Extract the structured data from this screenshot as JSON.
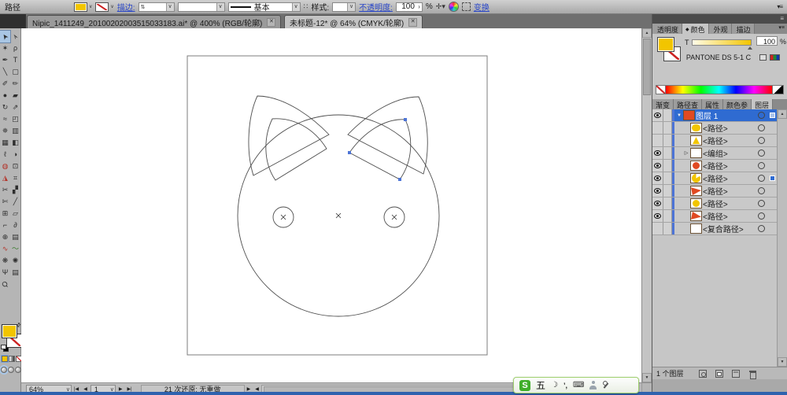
{
  "control_bar": {
    "context_label": "路径",
    "stroke_label": "描边:",
    "brush_name": "基本",
    "style_label": "样式:",
    "opacity_label": "不透明度:",
    "opacity_value": "100",
    "opacity_unit": "%",
    "transform_label": "变换"
  },
  "document_tabs": [
    {
      "title": "Nipic_1411249_20100202003515033183.ai* @ 400% (RGB/轮廓)"
    },
    {
      "title": "未标题-12* @ 64% (CMYK/轮廓)"
    }
  ],
  "toolbar": {
    "tools": [
      {
        "name": "selection-tool",
        "glyph": "➤",
        "cls": "active arrow"
      },
      {
        "name": "direct-selection-tool",
        "glyph": "➢",
        "cls": "arrow"
      },
      {
        "name": "magic-wand-tool",
        "glyph": "✶"
      },
      {
        "name": "lasso-tool",
        "glyph": "ρ"
      },
      {
        "name": "pen-tool",
        "glyph": "✒"
      },
      {
        "name": "type-tool",
        "glyph": "T"
      },
      {
        "name": "line-segment-tool",
        "glyph": "╲"
      },
      {
        "name": "rectangle-tool",
        "glyph": "▢"
      },
      {
        "name": "paintbrush-tool",
        "glyph": "✐"
      },
      {
        "name": "pencil-tool",
        "glyph": "✏"
      },
      {
        "name": "blob-brush-tool",
        "glyph": "●"
      },
      {
        "name": "eraser-tool",
        "glyph": "▰"
      },
      {
        "name": "rotate-tool",
        "glyph": "↻"
      },
      {
        "name": "scale-tool",
        "glyph": "⇗"
      },
      {
        "name": "warp-tool",
        "glyph": "≈"
      },
      {
        "name": "free-transform-tool",
        "glyph": "◰"
      },
      {
        "name": "symbol-sprayer-tool",
        "glyph": "✵"
      },
      {
        "name": "column-graph-tool",
        "glyph": "▥"
      },
      {
        "name": "mesh-tool",
        "glyph": "▦"
      },
      {
        "name": "gradient-tool",
        "glyph": "◧"
      },
      {
        "name": "eyedropper-tool",
        "glyph": "ℓ"
      },
      {
        "name": "blend-tool",
        "glyph": "◑"
      },
      {
        "name": "live-paint-bucket-tool",
        "glyph": "◍",
        "cls": "c-red"
      },
      {
        "name": "live-paint-selection-tool",
        "glyph": "⊡"
      },
      {
        "name": "live-trace-tool",
        "glyph": "◮",
        "cls": "c-red"
      },
      {
        "name": "crop-area-tool",
        "glyph": "⌗"
      },
      {
        "name": "slice-tool",
        "glyph": "✂"
      },
      {
        "name": "slice-selection-tool",
        "glyph": "▞"
      },
      {
        "name": "scissors-tool",
        "glyph": "✄"
      },
      {
        "name": "knife-tool",
        "glyph": "╱"
      },
      {
        "name": "artboard-tool",
        "glyph": "⊞"
      },
      {
        "name": "page-tool",
        "glyph": "▱"
      },
      {
        "name": "measure-tool",
        "glyph": "⌐"
      },
      {
        "name": "spiral-tool",
        "glyph": "∂"
      },
      {
        "name": "polar-grid-tool",
        "glyph": "⊕"
      },
      {
        "name": "rectangular-grid-tool",
        "glyph": "▤"
      },
      {
        "name": "width-tool",
        "glyph": "∿",
        "cls": "c-red"
      },
      {
        "name": "wrinkle-tool",
        "glyph": "〜",
        "cls": "c-green"
      },
      {
        "name": "bloat-tool",
        "glyph": "❋"
      },
      {
        "name": "twirl-tool",
        "glyph": "✺"
      },
      {
        "name": "hand-tool",
        "glyph": "Ψ"
      },
      {
        "name": "print-tiling-tool",
        "glyph": "▤"
      },
      {
        "name": "zoom-tool",
        "glyph": "Ϙ",
        "cls": "rotz"
      },
      {
        "name": "empty-slot",
        "glyph": ""
      }
    ]
  },
  "panels": {
    "group1_tabs": [
      {
        "name": "tab-transparency",
        "label": "透明度"
      },
      {
        "name": "tab-color",
        "label": "颜色",
        "cls": "active",
        "icon": "◆"
      },
      {
        "name": "tab-appearance",
        "label": "外观"
      },
      {
        "name": "tab-stroke",
        "label": "描边"
      }
    ],
    "color": {
      "tint_label": "T",
      "tint_value": "100",
      "tint_unit": "%",
      "swatch_name": "PANTONE DS 5-1 C"
    },
    "group2_tabs": [
      {
        "name": "tab-gradient",
        "label": "渐变"
      },
      {
        "name": "tab-pathfinder",
        "label": "路径查"
      },
      {
        "name": "tab-attributes",
        "label": "属性"
      },
      {
        "name": "tab-color-guide",
        "label": "颜色参"
      },
      {
        "name": "tab-layers",
        "label": "图层",
        "cls": "active"
      }
    ],
    "layers": {
      "rows": [
        {
          "name": "layer-row-layer1",
          "label": "图层 1",
          "eye": true,
          "thumb": "t-red",
          "rowcls": "sel",
          "expander": "▼",
          "selchip": "chip-light"
        },
        {
          "name": "layer-row-path",
          "label": "<路径>",
          "eye": false,
          "thumb": "t-yellow-round",
          "rowcls": "ind"
        },
        {
          "name": "layer-row-path",
          "label": "<路径>",
          "eye": false,
          "thumb": "t-yellow-person",
          "rowcls": "ind"
        },
        {
          "name": "layer-row-group",
          "label": "<编组>",
          "eye": true,
          "thumb": "t-white",
          "expander": "▷",
          "rowcls": "ind"
        },
        {
          "name": "layer-row-path",
          "label": "<路径>",
          "eye": true,
          "thumb": "t-orange-circle",
          "rowcls": "ind"
        },
        {
          "name": "layer-row-path",
          "label": "<路径>",
          "eye": true,
          "thumb": "t-yellow-pie",
          "rowcls": "ind",
          "selchip": "chip-blue"
        },
        {
          "name": "layer-row-path",
          "label": "<路径>",
          "eye": true,
          "thumb": "t-orange-tri-left",
          "rowcls": "ind"
        },
        {
          "name": "layer-row-path",
          "label": "<路径>",
          "eye": true,
          "thumb": "t-yellow-circle",
          "rowcls": "ind"
        },
        {
          "name": "layer-row-path",
          "label": "<路径>",
          "eye": true,
          "thumb": "t-orange-tri-right",
          "rowcls": "ind"
        },
        {
          "name": "layer-row-compound-path",
          "label": "<复合路径>",
          "eye": false,
          "thumb": "t-white",
          "rowcls": "ind"
        }
      ],
      "count_text": "1 个图层"
    }
  },
  "status_bar": {
    "zoom": "64%",
    "artboard": "1",
    "status_text": "21 次还原: 无重做"
  },
  "ime": {
    "brand": "S",
    "mode": "五",
    "punct": "’,"
  },
  "colors": {
    "fill_yellow": "#f2c500",
    "selection_blue": "#2f6bd1",
    "artwork_orange": "#e04a22",
    "link_blue": "#2a47c9",
    "ime_green": "#3fae2a"
  }
}
